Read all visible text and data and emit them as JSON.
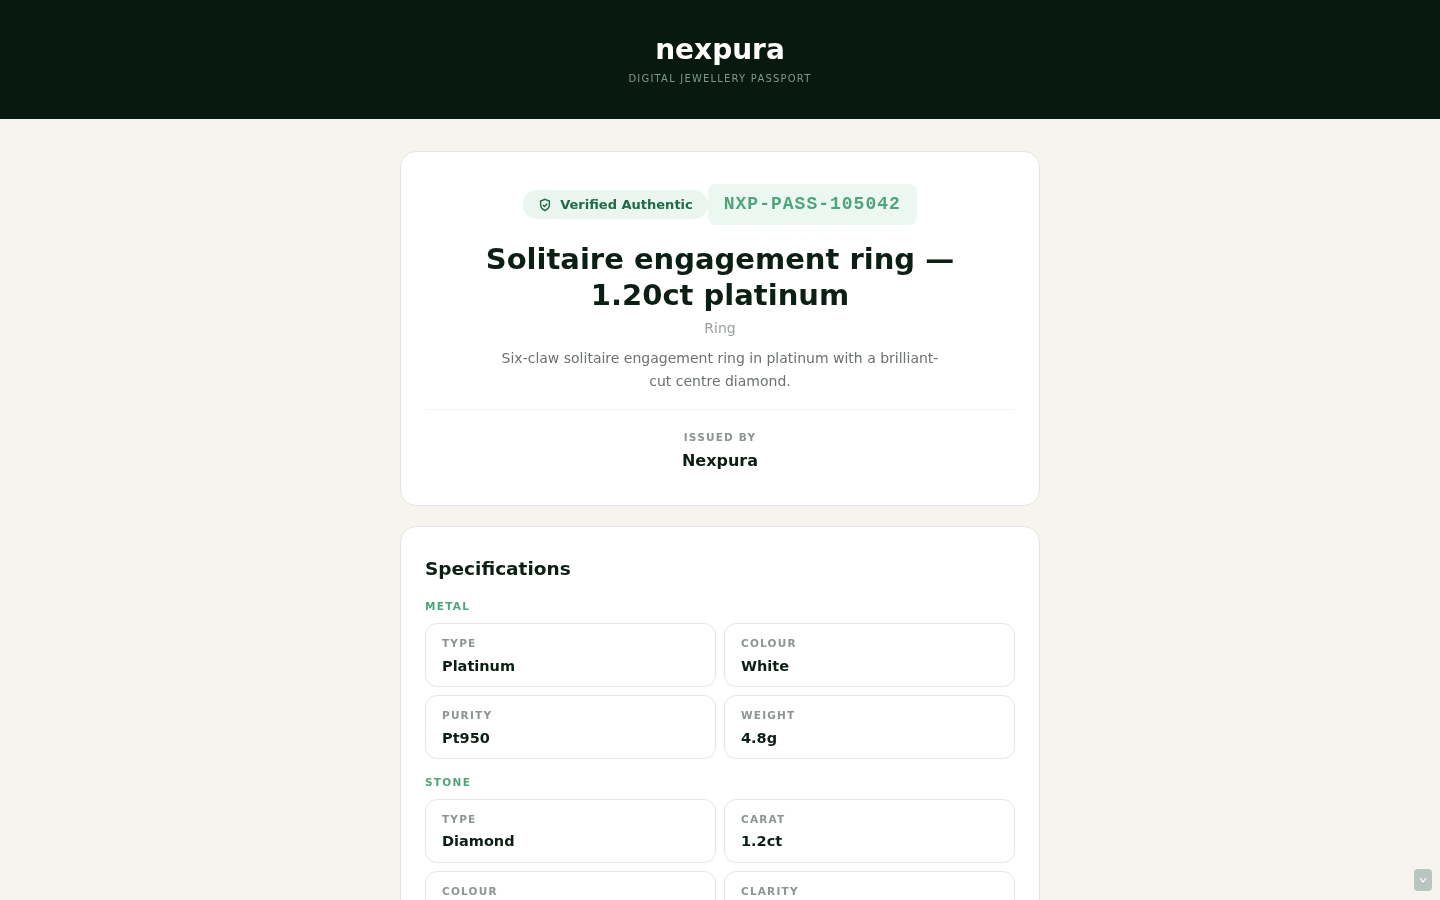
{
  "brand": {
    "name": "nexpura",
    "tagline": "DIGITAL JEWELLERY PASSPORT"
  },
  "passport": {
    "verified": true,
    "verified_label": "Verified Authentic",
    "code": "NXP-PASS-105042",
    "title": "Solitaire engagement ring — 1.20ct platinum",
    "category": "Ring",
    "description": "Six-claw solitaire engagement ring in platinum with a brilliant-cut centre diamond.",
    "issued_by_label": "ISSUED BY",
    "issuer": "Nexpura"
  },
  "specifications": {
    "title": "Specifications",
    "groups": [
      {
        "label": "METAL",
        "fields": [
          {
            "label": "TYPE",
            "value": "Platinum"
          },
          {
            "label": "COLOUR",
            "value": "White"
          },
          {
            "label": "PURITY",
            "value": "Pt950"
          },
          {
            "label": "WEIGHT",
            "value": "4.8g"
          }
        ]
      },
      {
        "label": "STONE",
        "fields": [
          {
            "label": "TYPE",
            "value": "Diamond"
          },
          {
            "label": "CARAT",
            "value": "1.2ct"
          },
          {
            "label": "COLOUR"
          },
          {
            "label": "CLARITY"
          }
        ]
      }
    ]
  }
}
